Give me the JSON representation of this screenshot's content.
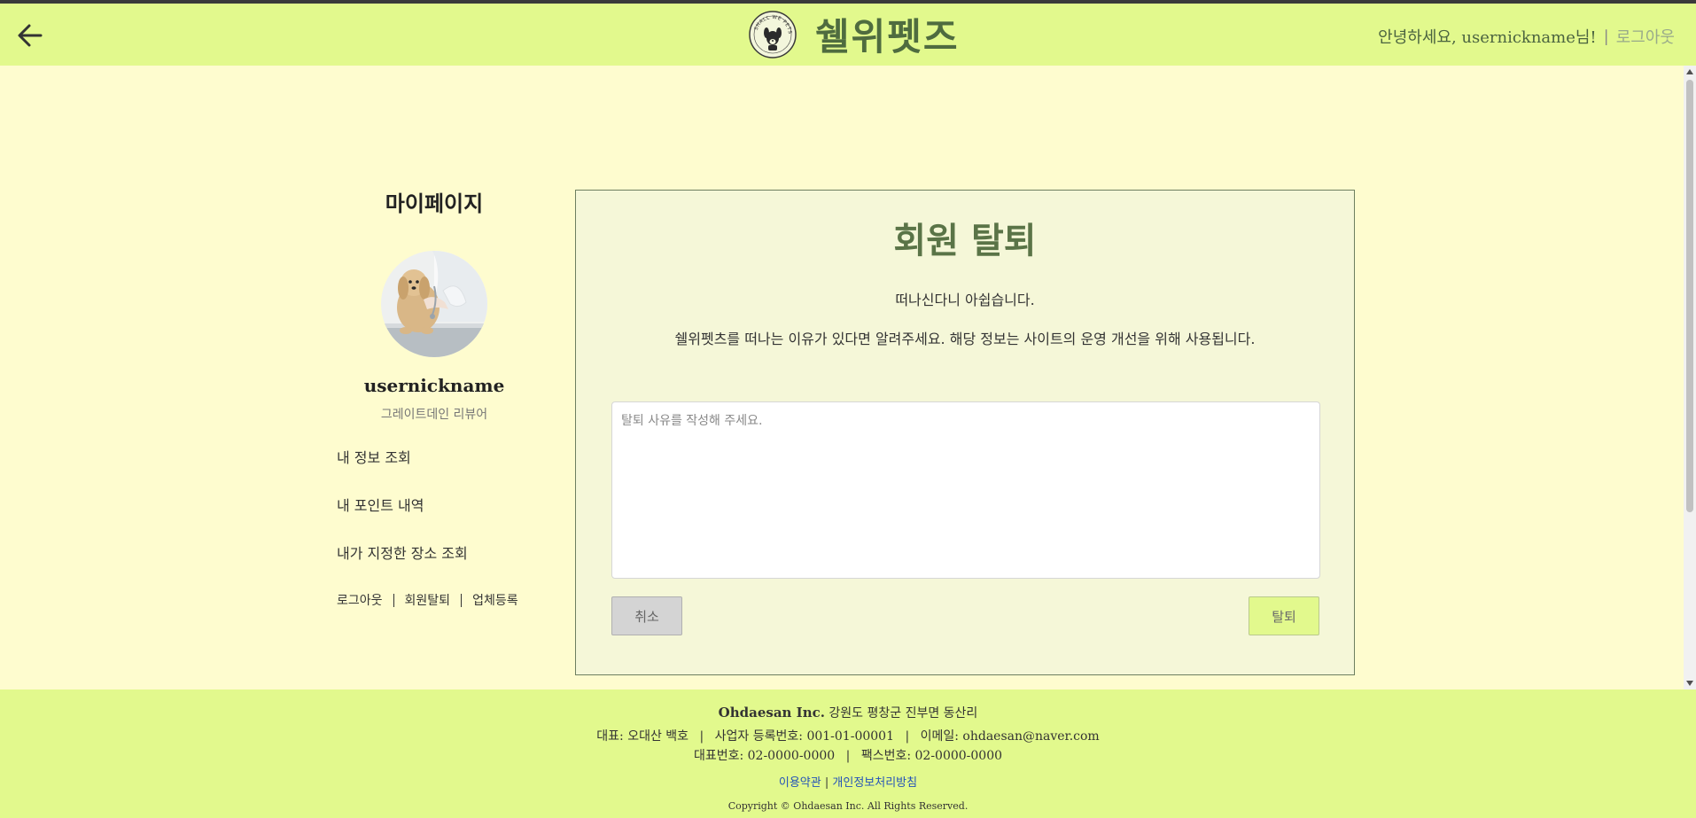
{
  "header": {
    "brand": "쉘위펫즈",
    "logo_text": "SHALL WE PETS",
    "greeting": "안녕하세요, usernickname님!",
    "separator": "|",
    "logout": "로그아웃"
  },
  "sidebar": {
    "title": "마이페이지",
    "nickname": "usernickname",
    "rank": "그레이트데인 리뷰어",
    "menu": [
      "내 정보 조회",
      "내 포인트 내역",
      "내가 지정한 장소 조회"
    ],
    "links": [
      "로그아웃",
      "회원탈퇴",
      "업체등록"
    ]
  },
  "main": {
    "title": "회원 탈퇴",
    "message1": "떠나신다니 아쉽습니다.",
    "message2": "쉘위펫츠를 떠나는 이유가 있다면 알려주세요. 해당 정보는 사이트의 운영 개선을 위해 사용됩니다.",
    "reason_placeholder": "탈퇴 사유를 작성해 주세요.",
    "reason_value": "",
    "cancel_label": "취소",
    "withdraw_label": "탈퇴"
  },
  "footer": {
    "company": "Ohdaesan Inc.",
    "address": "강원도 평창군 진부면 동산리",
    "ceo": "대표: 오대산 백호",
    "biz_no": "사업자 등록번호: 001-01-00001",
    "email": "이메일: ohdaesan@naver.com",
    "phone": "대표번호: 02-0000-0000",
    "fax": "팩스번호: 02-0000-0000",
    "terms": "이용약관",
    "privacy": "개인정보처리방침",
    "copyright": "Copyright © Ohdaesan Inc. All Rights Reserved.",
    "divider": "|"
  },
  "colors": {
    "header_bg": "#e2f98d",
    "page_bg": "#fefccf",
    "panel_bg": "#f5f7d8",
    "accent_green": "#5a7447",
    "link_blue": "#2453b8"
  },
  "icons": [
    "back-arrow-icon",
    "brand-logo",
    "user-avatar"
  ]
}
